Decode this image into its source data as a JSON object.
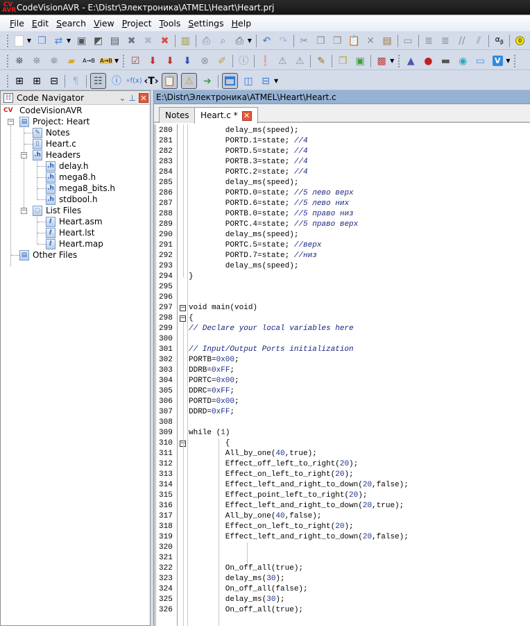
{
  "window": {
    "app_logo": "CV AVR",
    "title": "CodeVisionAVR - E:\\Distr\\Электроника\\ATMEL\\Heart\\Heart.prj"
  },
  "menu": [
    {
      "label": "File",
      "accel": "F"
    },
    {
      "label": "Edit",
      "accel": "E"
    },
    {
      "label": "Search",
      "accel": "S"
    },
    {
      "label": "View",
      "accel": "V"
    },
    {
      "label": "Project",
      "accel": "P"
    },
    {
      "label": "Tools",
      "accel": "T"
    },
    {
      "label": "Settings",
      "accel": "S"
    },
    {
      "label": "Help",
      "accel": "H"
    }
  ],
  "toolbars": {
    "row1": [
      "new-file",
      "open-file",
      "reopen",
      "save",
      "save-as",
      "save-all",
      "close",
      "close-all",
      "close-project",
      "library",
      "print-setup",
      "print-preview",
      "print",
      "undo",
      "redo",
      "cut",
      "copy",
      "copy-special",
      "paste",
      "delete",
      "insert-template",
      "toggle-ruler",
      "indent",
      "unindent",
      "comment",
      "uncomment",
      "greek-chars",
      "ascii-chars"
    ],
    "row2": [
      "find",
      "find-next",
      "find-previous",
      "find-in-files",
      "replace",
      "replace-in-files",
      "new-note",
      "go-to-bookmark",
      "go-to-next",
      "go-to-prev",
      "stop",
      "clean",
      "info",
      "warning-next",
      "warning-prev",
      "warning-first",
      "edit",
      "copy-files",
      "paste-files",
      "configure",
      "codewizard",
      "debugger",
      "chip-programmer",
      "run-tool",
      "terminal",
      "visualstudio"
    ],
    "row3": [
      "expand-all",
      "expand",
      "collapse",
      "show-whitespace",
      "code-navigator",
      "code-info",
      "function-call-tree",
      "code-templates",
      "clipboard-history",
      "messages",
      "output-files",
      "single-editor",
      "split-vertical",
      "split-horizontal"
    ]
  },
  "navigator": {
    "title": "Code Navigator",
    "root": "CodeVisionAVR",
    "project": "Project: Heart",
    "notes": "Notes",
    "main_file": "Heart.c",
    "headers": {
      "label": "Headers",
      "items": [
        "delay.h",
        "mega8.h",
        "mega8_bits.h",
        "stdbool.h"
      ]
    },
    "list_files": {
      "label": "List Files",
      "items": [
        "Heart.asm",
        "Heart.lst",
        "Heart.map"
      ]
    },
    "other_files": "Other Files"
  },
  "editor": {
    "path": "E:\\Distr\\Электроника\\ATMEL\\Heart\\Heart.c",
    "tabs": [
      {
        "label": "Notes",
        "active": false
      },
      {
        "label": "Heart.c *",
        "active": true
      }
    ],
    "lines": [
      {
        "n": "280",
        "code": "        delay_ms(speed);"
      },
      {
        "n": "281",
        "code": "        PORTD.1=state; ",
        "comment": "//4"
      },
      {
        "n": "282",
        "code": "        PORTD.5=state; ",
        "comment": "//4"
      },
      {
        "n": "283",
        "code": "        PORTB.3=state; ",
        "comment": "//4"
      },
      {
        "n": "284",
        "code": "        PORTC.2=state; ",
        "comment": "//4"
      },
      {
        "n": "285",
        "code": "        delay_ms(speed);"
      },
      {
        "n": "286",
        "code": "        PORTD.0=state; ",
        "comment": "//5 лево верх"
      },
      {
        "n": "287",
        "code": "        PORTD.6=state; ",
        "comment": "//5 лево них"
      },
      {
        "n": "288",
        "code": "        PORTB.0=state; ",
        "comment": "//5 право низ"
      },
      {
        "n": "289",
        "code": "        PORTC.4=state; ",
        "comment": "//5 право верх"
      },
      {
        "n": "290",
        "code": "        delay_ms(speed);"
      },
      {
        "n": "291",
        "code": "        PORTC.5=state; ",
        "comment": "//верх"
      },
      {
        "n": "292",
        "code": "        PORTD.7=state; ",
        "comment": "//низ"
      },
      {
        "n": "293",
        "code": "        delay_ms(speed);"
      },
      {
        "n": "294",
        "code": "}"
      },
      {
        "n": "295",
        "code": ""
      },
      {
        "n": "296",
        "code": ""
      },
      {
        "n": "297",
        "code": "void main(void)",
        "fold": true
      },
      {
        "n": "298",
        "code": "{",
        "fold": true
      },
      {
        "n": "299",
        "code": "",
        "comment": "// Declare your local variables here"
      },
      {
        "n": "300",
        "code": ""
      },
      {
        "n": "301",
        "code": "",
        "comment": "// Input/Output Ports initialization"
      },
      {
        "n": "302",
        "code": "PORTB=",
        "num": "0x00",
        "tail": ";"
      },
      {
        "n": "303",
        "code": "DDRB=",
        "num": "0xFF",
        "tail": ";"
      },
      {
        "n": "304",
        "code": "PORTC=",
        "num": "0x00",
        "tail": ";"
      },
      {
        "n": "305",
        "code": "DDRC=",
        "num": "0xFF",
        "tail": ";"
      },
      {
        "n": "306",
        "code": "PORTD=",
        "num": "0x00",
        "tail": ";"
      },
      {
        "n": "307",
        "code": "DDRD=",
        "num": "0xFF",
        "tail": ";"
      },
      {
        "n": "308",
        "code": ""
      },
      {
        "n": "309",
        "code": "while (",
        "num": "1",
        "tail": ")"
      },
      {
        "n": "310",
        "code": "        {",
        "fold": true
      },
      {
        "n": "311",
        "code": "        All_by_one(",
        "num": "40",
        "tail": ",true);"
      },
      {
        "n": "312",
        "code": "        Effect_off_left_to_right(",
        "num": "20",
        "tail": ");"
      },
      {
        "n": "313",
        "code": "        Effect_on_left_to_right(",
        "num": "20",
        "tail": ");"
      },
      {
        "n": "314",
        "code": "        Effect_left_and_right_to_down(",
        "num": "20",
        "tail": ",false);"
      },
      {
        "n": "315",
        "code": "        Effect_point_left_to_right(",
        "num": "20",
        "tail": ");"
      },
      {
        "n": "316",
        "code": "        Effect_left_and_right_to_down(",
        "num": "20",
        "tail": ",true);"
      },
      {
        "n": "317",
        "code": "        All_by_one(",
        "num": "40",
        "tail": ",false);"
      },
      {
        "n": "318",
        "code": "        Effect_on_left_to_right(",
        "num": "20",
        "tail": ");"
      },
      {
        "n": "319",
        "code": "        Effect_left_and_right_to_down(",
        "num": "20",
        "tail": ",false);"
      },
      {
        "n": "320",
        "code": ""
      },
      {
        "n": "321",
        "code": ""
      },
      {
        "n": "322",
        "code": "        On_off_all(true);"
      },
      {
        "n": "323",
        "code": "        delay_ms(",
        "num": "30",
        "tail": ");"
      },
      {
        "n": "324",
        "code": "        On_off_all(false);"
      },
      {
        "n": "325",
        "code": "        delay_ms(",
        "num": "30",
        "tail": ");"
      },
      {
        "n": "326",
        "code": "        On_off_all(true);"
      }
    ]
  }
}
